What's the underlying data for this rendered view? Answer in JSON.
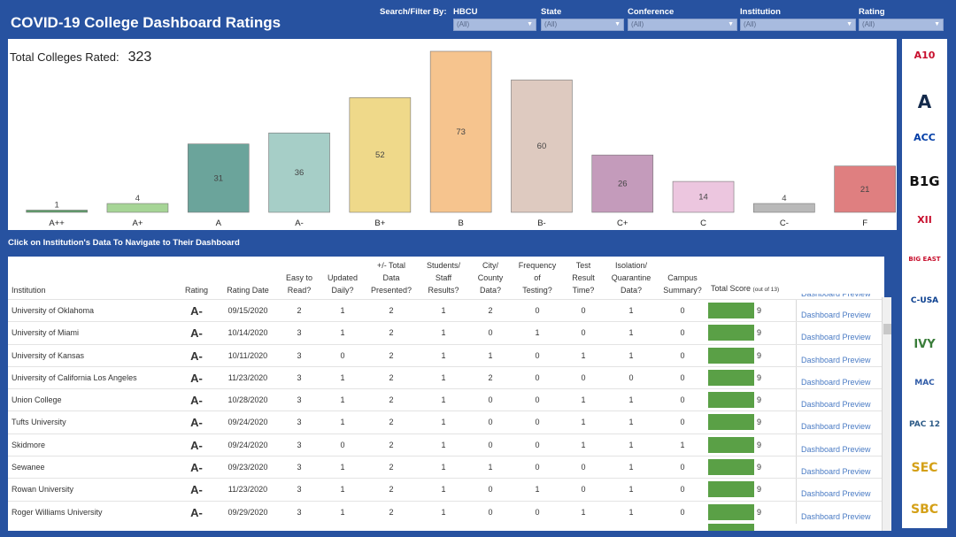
{
  "header": {
    "title": "COVID-19 College Dashboard Ratings"
  },
  "filters": {
    "label": "Search/Filter By:",
    "items": [
      {
        "label": "HBCU",
        "value": "(All)"
      },
      {
        "label": "State",
        "value": "(All)"
      },
      {
        "label": "Conference",
        "value": "(All)"
      },
      {
        "label": "Institution",
        "value": "(All)"
      },
      {
        "label": "Rating",
        "value": "(All)"
      }
    ]
  },
  "summary": {
    "label": "Total Colleges Rated:",
    "value": "323"
  },
  "chart_data": {
    "type": "bar",
    "categories": [
      "A++",
      "A+",
      "A",
      "A-",
      "B+",
      "B",
      "B-",
      "C+",
      "C",
      "C-",
      "F"
    ],
    "values": [
      1,
      4,
      31,
      36,
      52,
      73,
      60,
      26,
      14,
      4,
      21
    ],
    "colors": [
      "#5e9d6a",
      "#a6d596",
      "#6ba49b",
      "#a6cec7",
      "#efd98a",
      "#f6c48e",
      "#decac0",
      "#c49bbb",
      "#ecc6df",
      "#b9b9b9",
      "#df7f80"
    ],
    "title": "",
    "xlabel": "",
    "ylabel": "",
    "ylim": [
      0,
      75
    ],
    "grid": false
  },
  "nav_hint": "Click on Institution's Data To Navigate to Their Dashboard",
  "table": {
    "headers": {
      "institution": "Institution",
      "rating": "Rating",
      "rating_date": "Rating Date",
      "easy_to_read": [
        "Easy to",
        "Read?"
      ],
      "updated_daily": [
        "Updated",
        "Daily?"
      ],
      "total_data": [
        "+/- Total",
        "Data",
        "Presented?"
      ],
      "students_staff": [
        "Students/",
        "Staff",
        "Results?"
      ],
      "city_county": [
        "City/",
        "County",
        "Data?"
      ],
      "frequency": [
        "Frequency",
        "of",
        "Testing?"
      ],
      "test_result": [
        "Test",
        "Result",
        "Time?"
      ],
      "isolation": [
        "Isolation/",
        "Quarantine",
        "Data?"
      ],
      "campus_summary": [
        "Campus",
        "Summary?"
      ],
      "total_score": "Total Score",
      "total_score_sub": "(out of 13)"
    },
    "link_label": "Dashboard Preview",
    "rows": [
      {
        "institution": "University of Oklahoma",
        "rating": "A-",
        "date": "09/15/2020",
        "easy": "2",
        "updated": "1",
        "total": "2",
        "students": "1",
        "city": "2",
        "freq": "0",
        "test": "0",
        "isolation": "1",
        "campus": "0",
        "score": "9"
      },
      {
        "institution": "University of Miami",
        "rating": "A-",
        "date": "10/14/2020",
        "easy": "3",
        "updated": "1",
        "total": "2",
        "students": "1",
        "city": "0",
        "freq": "1",
        "test": "0",
        "isolation": "1",
        "campus": "0",
        "score": "9"
      },
      {
        "institution": "University of Kansas",
        "rating": "A-",
        "date": "10/11/2020",
        "easy": "3",
        "updated": "0",
        "total": "2",
        "students": "1",
        "city": "1",
        "freq": "0",
        "test": "1",
        "isolation": "1",
        "campus": "0",
        "score": "9"
      },
      {
        "institution": "University of California Los Angeles",
        "rating": "A-",
        "date": "11/23/2020",
        "easy": "3",
        "updated": "1",
        "total": "2",
        "students": "1",
        "city": "2",
        "freq": "0",
        "test": "0",
        "isolation": "0",
        "campus": "0",
        "score": "9"
      },
      {
        "institution": "Union College",
        "rating": "A-",
        "date": "10/28/2020",
        "easy": "3",
        "updated": "1",
        "total": "2",
        "students": "1",
        "city": "0",
        "freq": "0",
        "test": "1",
        "isolation": "1",
        "campus": "0",
        "score": "9"
      },
      {
        "institution": "Tufts University",
        "rating": "A-",
        "date": "09/24/2020",
        "easy": "3",
        "updated": "1",
        "total": "2",
        "students": "1",
        "city": "0",
        "freq": "0",
        "test": "1",
        "isolation": "1",
        "campus": "0",
        "score": "9"
      },
      {
        "institution": "Skidmore",
        "rating": "A-",
        "date": "09/24/2020",
        "easy": "3",
        "updated": "0",
        "total": "2",
        "students": "1",
        "city": "0",
        "freq": "0",
        "test": "1",
        "isolation": "1",
        "campus": "1",
        "score": "9"
      },
      {
        "institution": "Sewanee",
        "rating": "A-",
        "date": "09/23/2020",
        "easy": "3",
        "updated": "1",
        "total": "2",
        "students": "1",
        "city": "1",
        "freq": "0",
        "test": "0",
        "isolation": "1",
        "campus": "0",
        "score": "9"
      },
      {
        "institution": "Rowan University",
        "rating": "A-",
        "date": "11/23/2020",
        "easy": "3",
        "updated": "1",
        "total": "2",
        "students": "1",
        "city": "0",
        "freq": "1",
        "test": "0",
        "isolation": "1",
        "campus": "0",
        "score": "9"
      },
      {
        "institution": "Roger Williams University",
        "rating": "A-",
        "date": "09/29/2020",
        "easy": "3",
        "updated": "1",
        "total": "2",
        "students": "1",
        "city": "0",
        "freq": "0",
        "test": "1",
        "isolation": "1",
        "campus": "0",
        "score": "9"
      }
    ]
  },
  "conference_logos": [
    {
      "name": "a10-logo",
      "text": "A10",
      "color": "#c8102e"
    },
    {
      "name": "american-logo",
      "text": "A",
      "color": "#13294b"
    },
    {
      "name": "acc-logo",
      "text": "ACC",
      "color": "#013ca6"
    },
    {
      "name": "big-ten-logo",
      "text": "B1G",
      "color": "#111111"
    },
    {
      "name": "big-12-logo",
      "text": "XII",
      "color": "#c8102e"
    },
    {
      "name": "big-east-logo",
      "text": "BIG EAST",
      "color": "#c8102e"
    },
    {
      "name": "cusa-logo",
      "text": "C-USA",
      "color": "#0b3f8f"
    },
    {
      "name": "ivy-league-logo",
      "text": "IVY",
      "color": "#3a7d3a"
    },
    {
      "name": "mac-logo",
      "text": "MAC",
      "color": "#2f5ba7"
    },
    {
      "name": "pac-12-logo",
      "text": "PAC 12",
      "color": "#2d5b87"
    },
    {
      "name": "sec-logo",
      "text": "SEC",
      "color": "#d4a017"
    },
    {
      "name": "sbc-logo",
      "text": "SBC",
      "color": "#d4a017"
    }
  ]
}
